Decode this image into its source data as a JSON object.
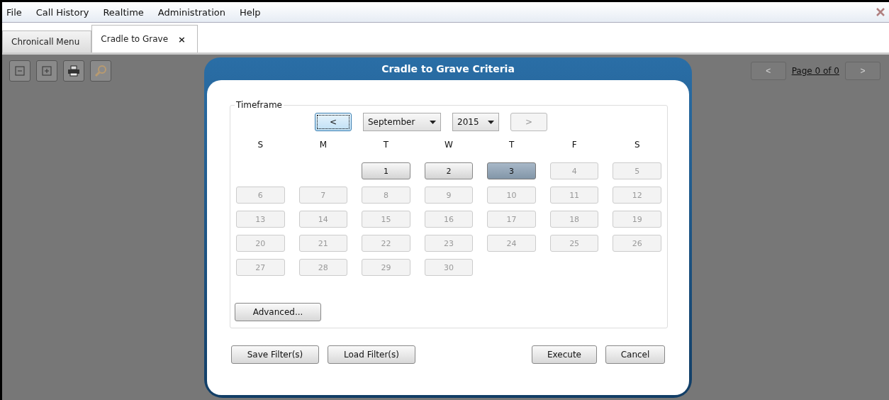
{
  "menu": [
    "File",
    "Call History",
    "Realtime",
    "Administration",
    "Help"
  ],
  "tabs": [
    {
      "label": "Chronicall Menu",
      "selected": false
    },
    {
      "label": "Cradle to Grave",
      "selected": true,
      "close": "×"
    }
  ],
  "pager": {
    "prev": "<",
    "label": "Page 0 of 0",
    "next": ">"
  },
  "dialog": {
    "title": "Cradle to Grave Criteria",
    "timeframe": {
      "legend": "Timeframe",
      "prev": "<",
      "month": "September",
      "year": "2015",
      "next": ">",
      "weekdays": [
        "S",
        "M",
        "T",
        "W",
        "T",
        "F",
        "S"
      ],
      "weeks": [
        [
          {
            "kind": "empty"
          },
          {
            "kind": "empty"
          },
          {
            "kind": "day",
            "label": "1",
            "disabled": false,
            "selected": false
          },
          {
            "kind": "day",
            "label": "2",
            "disabled": false,
            "selected": false
          },
          {
            "kind": "day",
            "label": "3",
            "disabled": false,
            "selected": true
          },
          {
            "kind": "day",
            "label": "4",
            "disabled": true,
            "selected": false
          },
          {
            "kind": "day",
            "label": "5",
            "disabled": true,
            "selected": false
          }
        ],
        [
          {
            "kind": "day",
            "label": "6",
            "disabled": true,
            "selected": false
          },
          {
            "kind": "day",
            "label": "7",
            "disabled": true,
            "selected": false
          },
          {
            "kind": "day",
            "label": "8",
            "disabled": true,
            "selected": false
          },
          {
            "kind": "day",
            "label": "9",
            "disabled": true,
            "selected": false
          },
          {
            "kind": "day",
            "label": "10",
            "disabled": true,
            "selected": false
          },
          {
            "kind": "day",
            "label": "11",
            "disabled": true,
            "selected": false
          },
          {
            "kind": "day",
            "label": "12",
            "disabled": true,
            "selected": false
          }
        ],
        [
          {
            "kind": "day",
            "label": "13",
            "disabled": true,
            "selected": false
          },
          {
            "kind": "day",
            "label": "14",
            "disabled": true,
            "selected": false
          },
          {
            "kind": "day",
            "label": "15",
            "disabled": true,
            "selected": false
          },
          {
            "kind": "day",
            "label": "16",
            "disabled": true,
            "selected": false
          },
          {
            "kind": "day",
            "label": "17",
            "disabled": true,
            "selected": false
          },
          {
            "kind": "day",
            "label": "18",
            "disabled": true,
            "selected": false
          },
          {
            "kind": "day",
            "label": "19",
            "disabled": true,
            "selected": false
          }
        ],
        [
          {
            "kind": "day",
            "label": "20",
            "disabled": true,
            "selected": false
          },
          {
            "kind": "day",
            "label": "21",
            "disabled": true,
            "selected": false
          },
          {
            "kind": "day",
            "label": "22",
            "disabled": true,
            "selected": false
          },
          {
            "kind": "day",
            "label": "23",
            "disabled": true,
            "selected": false
          },
          {
            "kind": "day",
            "label": "24",
            "disabled": true,
            "selected": false
          },
          {
            "kind": "day",
            "label": "25",
            "disabled": true,
            "selected": false
          },
          {
            "kind": "day",
            "label": "26",
            "disabled": true,
            "selected": false
          }
        ],
        [
          {
            "kind": "day",
            "label": "27",
            "disabled": true,
            "selected": false
          },
          {
            "kind": "day",
            "label": "28",
            "disabled": true,
            "selected": false
          },
          {
            "kind": "day",
            "label": "29",
            "disabled": true,
            "selected": false
          },
          {
            "kind": "day",
            "label": "30",
            "disabled": true,
            "selected": false
          },
          {
            "kind": "empty"
          },
          {
            "kind": "empty"
          },
          {
            "kind": "empty"
          }
        ]
      ],
      "advanced": "Advanced..."
    },
    "left_buttons": [
      "Save Filter(s)",
      "Load Filter(s)"
    ],
    "right_buttons": [
      "Execute",
      "Cancel"
    ]
  }
}
